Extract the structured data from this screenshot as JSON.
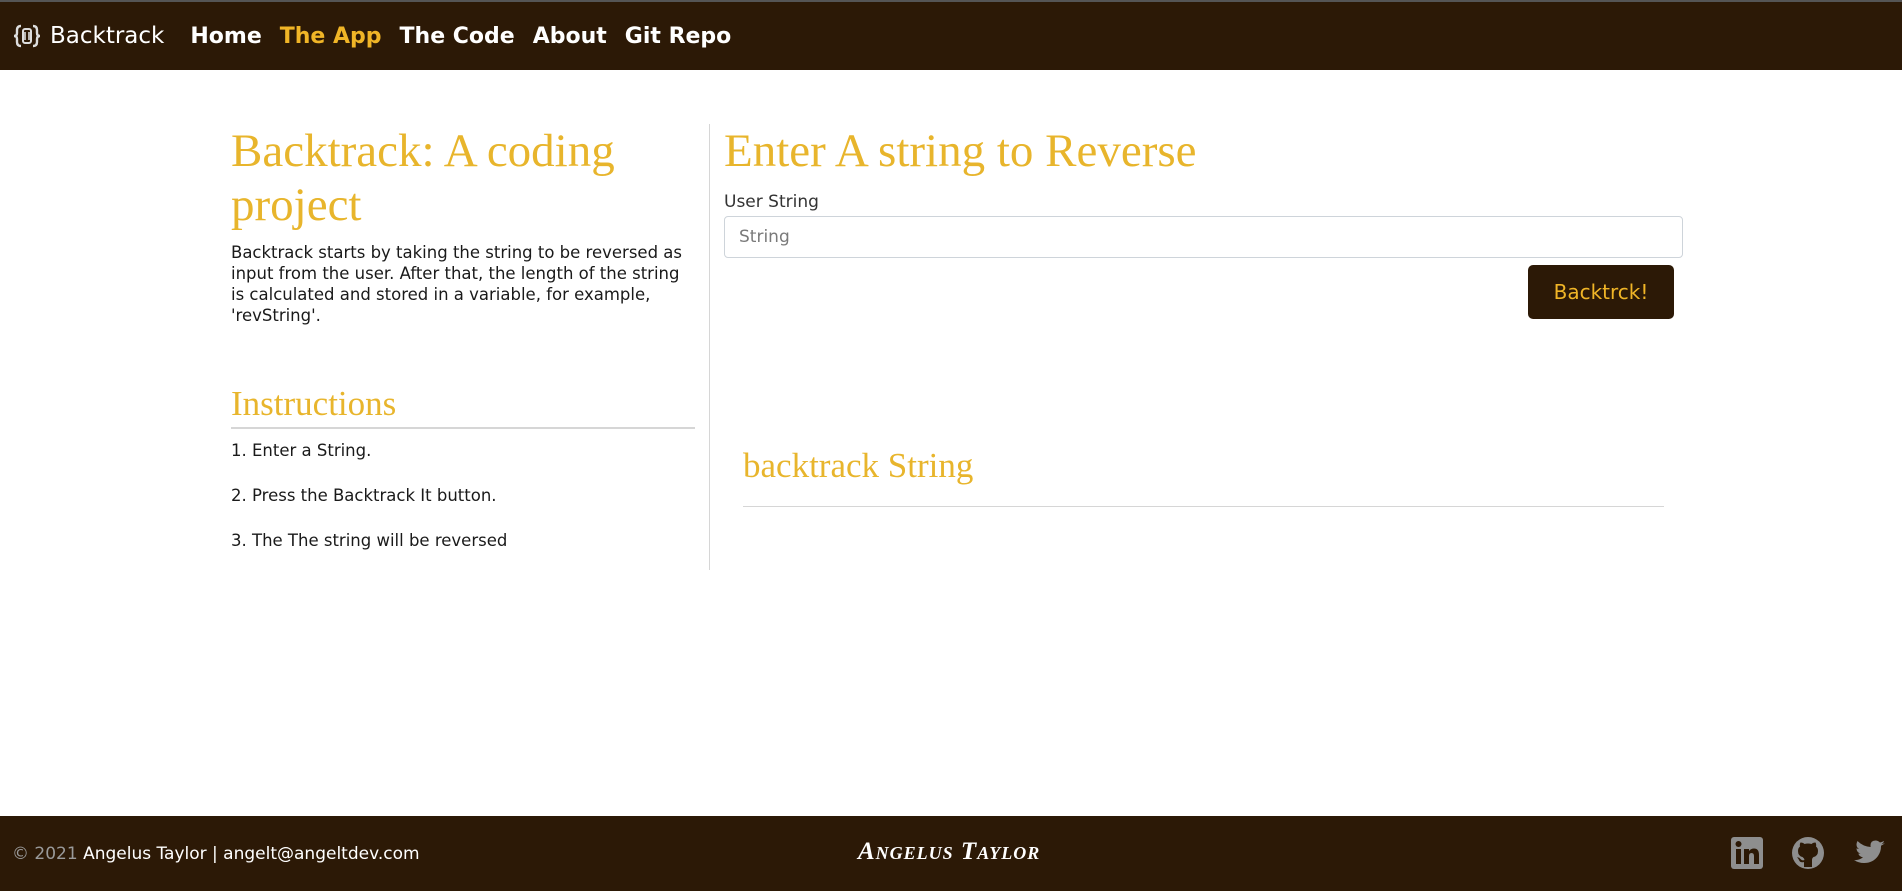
{
  "nav": {
    "brand": "Backtrack",
    "links": [
      {
        "label": "Home",
        "active": false
      },
      {
        "label": "The App",
        "active": true
      },
      {
        "label": "The Code",
        "active": false
      },
      {
        "label": "About",
        "active": false
      },
      {
        "label": "Git Repo",
        "active": false
      }
    ]
  },
  "intro": {
    "title": "Backtrack: A coding project",
    "description": "Backtrack starts by taking the string to be reversed as input from the user. After that, the length of the string is calculated and stored in a variable, for example, 'revString'."
  },
  "instructions": {
    "title": "Instructions",
    "steps": [
      "1. Enter a String.",
      "2. Press the Backtrack It button.",
      "3. The The string will be reversed"
    ]
  },
  "form": {
    "title": "Enter A string to Reverse",
    "label": "User String",
    "placeholder": "String",
    "value": "",
    "button": "Backtrck!"
  },
  "result": {
    "title": "backtrack String"
  },
  "footer": {
    "copyright": "© 2021",
    "owner": "Angelus Taylor | angelt@angeltdev.com",
    "logo_text": "Angelus Taylor",
    "social_icons": [
      "linkedin-icon",
      "github-icon",
      "twitter-icon"
    ]
  },
  "colors": {
    "nav_bg": "#2c1906",
    "accent": "#e8b52c",
    "active_link": "#f0b527"
  }
}
